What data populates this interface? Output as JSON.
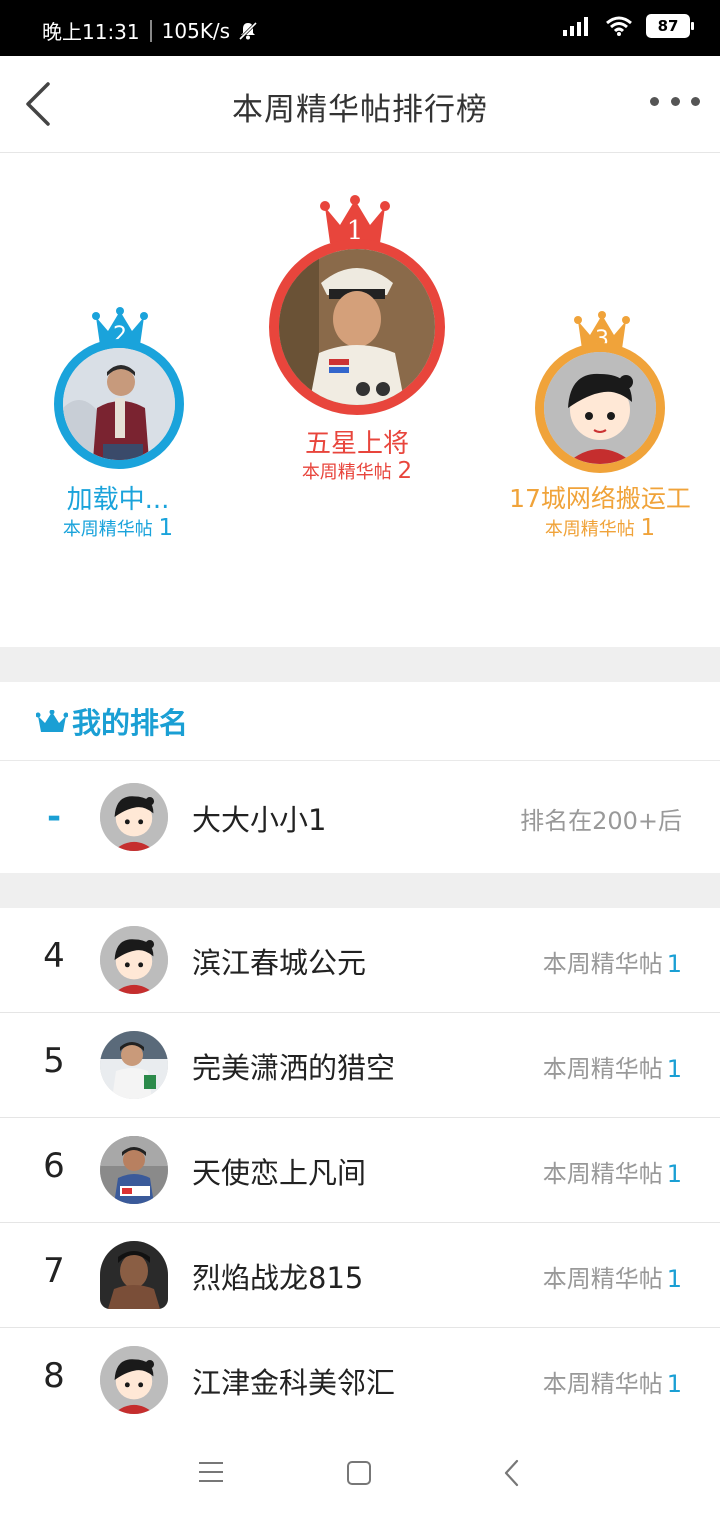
{
  "status_bar": {
    "time": "晚上11:31",
    "speed": "105K/s",
    "battery": "87"
  },
  "header": {
    "title": "本周精华帖排行榜"
  },
  "podium": {
    "first": {
      "rank": "1",
      "name": "五星上将",
      "count_label": "本周精华帖",
      "count": "2"
    },
    "second": {
      "rank": "2",
      "name": "加载中...",
      "count_label": "本周精华帖",
      "count": "1"
    },
    "third": {
      "rank": "3",
      "name": "17城网络搬运工",
      "count_label": "本周精华帖",
      "count": "1"
    }
  },
  "my_rank": {
    "title": "我的排名",
    "rank": "-",
    "name": "大大小小1",
    "note": "排名在200+后"
  },
  "list": [
    {
      "rank": "4",
      "name": "滨江春城公元",
      "count_label": "本周精华帖",
      "count": "1"
    },
    {
      "rank": "5",
      "name": "完美潇洒的猎空",
      "count_label": "本周精华帖",
      "count": "1"
    },
    {
      "rank": "6",
      "name": "天使恋上凡间",
      "count_label": "本周精华帖",
      "count": "1"
    },
    {
      "rank": "7",
      "name": "烈焰战龙815",
      "count_label": "本周精华帖",
      "count": "1"
    },
    {
      "rank": "8",
      "name": "江津金科美邻汇",
      "count_label": "本周精华帖",
      "count": "1"
    }
  ],
  "colors": {
    "gold_first": "#e8453c",
    "silver_second": "#1aa3db",
    "bronze_third": "#f0a33a",
    "accent": "#1a9fd4"
  },
  "icons": {
    "back": "chevron-left-icon",
    "more": "more-dots-icon",
    "crown": "crown-icon",
    "menu": "menu-icon",
    "home": "home-icon",
    "sys_back": "back-icon"
  }
}
